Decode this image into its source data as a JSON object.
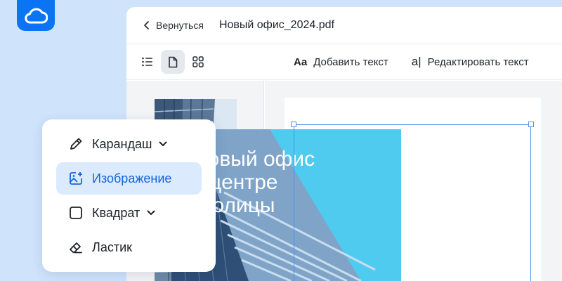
{
  "app": {
    "logo_icon": "cloud-icon",
    "brand_color": "#0a74f5"
  },
  "header": {
    "back_label": "Вернуться",
    "file_name": "Новый офис_2024.pdf"
  },
  "toolbar": {
    "view_modes": [
      {
        "icon": "list-icon",
        "active": false
      },
      {
        "icon": "page-icon",
        "active": true
      },
      {
        "icon": "grid-icon",
        "active": false
      }
    ],
    "add_text_glyph": "Aa",
    "add_text_label": "Добавить текст",
    "edit_text_glyph": "a|",
    "edit_text_label": "Редактировать текст"
  },
  "document": {
    "page_heading": "Новый офис\nв центре\nстолицы",
    "accent_color": "#4fcbf0",
    "selection_color": "#4a8ff0"
  },
  "tools": {
    "items": [
      {
        "label": "Карандаш",
        "icon": "pencil-icon",
        "has_dropdown": true,
        "active": false
      },
      {
        "label": "Изображение",
        "icon": "image-add-icon",
        "has_dropdown": false,
        "active": true
      },
      {
        "label": "Квадрат",
        "icon": "square-icon",
        "has_dropdown": true,
        "active": false
      },
      {
        "label": "Ластик",
        "icon": "eraser-icon",
        "has_dropdown": false,
        "active": false
      }
    ]
  }
}
